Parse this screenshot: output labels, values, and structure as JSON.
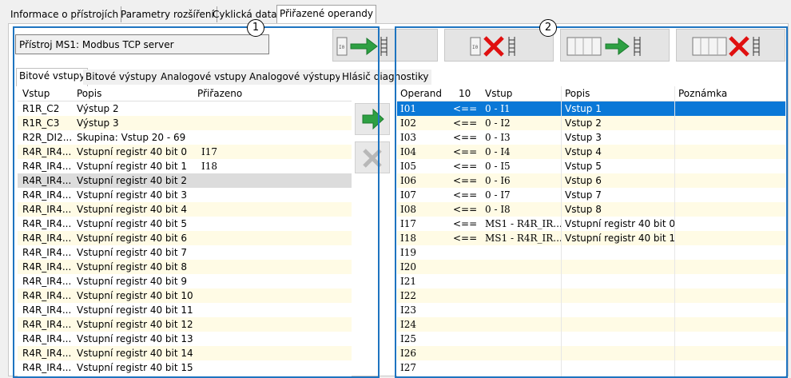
{
  "top_tabs": [
    "Informace o přístrojích",
    "Parametry rozšíření",
    "Cyklická data",
    "Přiřazené operandy"
  ],
  "device_label": "Přístroj MS1: Modbus TCP server",
  "callouts": [
    "1",
    "2"
  ],
  "sub_tabs": [
    "Bitové vstupy",
    "Bitové výstupy",
    "Analogové vstupy",
    "Analogové výstupy",
    "Hlásič diagnostiky"
  ],
  "left_grid": {
    "headers": [
      "Vstup",
      "Popis",
      "Přiřazeno"
    ],
    "rows": [
      {
        "vstup": "R1R_C2",
        "popis": "Výstup 2",
        "prirazeno": ""
      },
      {
        "vstup": "R1R_C3",
        "popis": "Výstup 3",
        "prirazeno": ""
      },
      {
        "vstup": "R2R_DI2...",
        "popis": "Skupina: Vstup 20 -  69",
        "prirazeno": ""
      },
      {
        "vstup": "R4R_IR4...",
        "popis": "Vstupní registr 40 bit 0",
        "prirazeno": "I17"
      },
      {
        "vstup": "R4R_IR4...",
        "popis": "Vstupní registr 40 bit 1",
        "prirazeno": "I18"
      },
      {
        "vstup": "R4R_IR4...",
        "popis": "Vstupní registr 40 bit 2",
        "prirazeno": ""
      },
      {
        "vstup": "R4R_IR4...",
        "popis": "Vstupní registr 40 bit 3",
        "prirazeno": ""
      },
      {
        "vstup": "R4R_IR4...",
        "popis": "Vstupní registr 40 bit 4",
        "prirazeno": ""
      },
      {
        "vstup": "R4R_IR4...",
        "popis": "Vstupní registr 40 bit 5",
        "prirazeno": ""
      },
      {
        "vstup": "R4R_IR4...",
        "popis": "Vstupní registr 40 bit 6",
        "prirazeno": ""
      },
      {
        "vstup": "R4R_IR4...",
        "popis": "Vstupní registr 40 bit 7",
        "prirazeno": ""
      },
      {
        "vstup": "R4R_IR4...",
        "popis": "Vstupní registr 40 bit 8",
        "prirazeno": ""
      },
      {
        "vstup": "R4R_IR4...",
        "popis": "Vstupní registr 40 bit 9",
        "prirazeno": ""
      },
      {
        "vstup": "R4R_IR4...",
        "popis": "Vstupní registr 40 bit 10",
        "prirazeno": ""
      },
      {
        "vstup": "R4R_IR4...",
        "popis": "Vstupní registr 40 bit 11",
        "prirazeno": ""
      },
      {
        "vstup": "R4R_IR4...",
        "popis": "Vstupní registr 40 bit 12",
        "prirazeno": ""
      },
      {
        "vstup": "R4R_IR4...",
        "popis": "Vstupní registr 40 bit 13",
        "prirazeno": ""
      },
      {
        "vstup": "R4R_IR4...",
        "popis": "Vstupní registr 40 bit 14",
        "prirazeno": ""
      },
      {
        "vstup": "R4R_IR4...",
        "popis": "Vstupní registr 40 bit 15",
        "prirazeno": ""
      }
    ]
  },
  "right_grid": {
    "headers": [
      "Operand",
      "10",
      "Vstup",
      "Popis",
      "Poznámka"
    ],
    "rows": [
      {
        "operand": "I01",
        "arrow": "<==",
        "vstup": "0 - I1",
        "popis": "Vstup 1",
        "poznamka": ""
      },
      {
        "operand": "I02",
        "arrow": "<==",
        "vstup": "0 - I2",
        "popis": "Vstup 2",
        "poznamka": ""
      },
      {
        "operand": "I03",
        "arrow": "<==",
        "vstup": "0 - I3",
        "popis": "Vstup 3",
        "poznamka": ""
      },
      {
        "operand": "I04",
        "arrow": "<==",
        "vstup": "0 - I4",
        "popis": "Vstup 4",
        "poznamka": ""
      },
      {
        "operand": "I05",
        "arrow": "<==",
        "vstup": "0 - I5",
        "popis": "Vstup 5",
        "poznamka": ""
      },
      {
        "operand": "I06",
        "arrow": "<==",
        "vstup": "0 - I6",
        "popis": "Vstup 6",
        "poznamka": ""
      },
      {
        "operand": "I07",
        "arrow": "<==",
        "vstup": "0 - I7",
        "popis": "Vstup 7",
        "poznamka": ""
      },
      {
        "operand": "I08",
        "arrow": "<==",
        "vstup": "0 - I8",
        "popis": "Vstup 8",
        "poznamka": ""
      },
      {
        "operand": "I17",
        "arrow": "<==",
        "vstup": "MS1 - R4R_IR...",
        "popis": "Vstupní registr 40 bit 0",
        "poznamka": ""
      },
      {
        "operand": "I18",
        "arrow": "<==",
        "vstup": "MS1 - R4R_IR...",
        "popis": "Vstupní registr 40 bit 1",
        "poznamka": ""
      },
      {
        "operand": "I19",
        "arrow": "",
        "vstup": "",
        "popis": "",
        "poznamka": ""
      },
      {
        "operand": "I20",
        "arrow": "",
        "vstup": "",
        "popis": "",
        "poznamka": ""
      },
      {
        "operand": "I21",
        "arrow": "",
        "vstup": "",
        "popis": "",
        "poznamka": ""
      },
      {
        "operand": "I22",
        "arrow": "",
        "vstup": "",
        "popis": "",
        "poznamka": ""
      },
      {
        "operand": "I23",
        "arrow": "",
        "vstup": "",
        "popis": "",
        "poznamka": ""
      },
      {
        "operand": "I24",
        "arrow": "",
        "vstup": "",
        "popis": "",
        "poznamka": ""
      },
      {
        "operand": "I25",
        "arrow": "",
        "vstup": "",
        "popis": "",
        "poznamka": ""
      },
      {
        "operand": "I26",
        "arrow": "",
        "vstup": "",
        "popis": "",
        "poznamka": ""
      },
      {
        "operand": "I27",
        "arrow": "",
        "vstup": "",
        "popis": "",
        "poznamka": ""
      }
    ]
  },
  "toolbar_icons": [
    "assign-arrow-icon",
    "unassign-x-icon",
    "assign-all-arrow-icon",
    "unassign-all-x-icon"
  ],
  "colors": {
    "selection": "#0a78d7",
    "alt_row": "#fffbe5",
    "callout": "#1e74c0",
    "arrow_green": "#2ea043",
    "x_red": "#e01010"
  }
}
